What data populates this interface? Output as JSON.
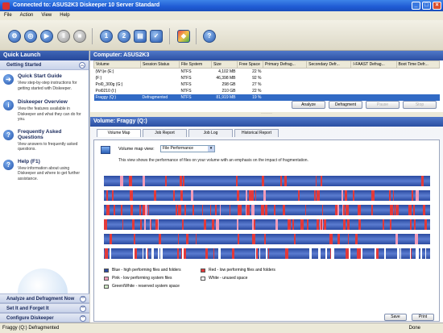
{
  "window": {
    "title": "Connected to: ASUS2K3 Diskeeper 10 Server Standard"
  },
  "menu": [
    "File",
    "Action",
    "View",
    "Help"
  ],
  "left_panel": {
    "header": "Quick Launch",
    "section": "Getting Started",
    "items": [
      {
        "title": "Quick Start Guide",
        "desc": "View step-by-step instructions for getting started with Diskeeper."
      },
      {
        "title": "Diskeeper Overview",
        "desc": "View the features available in Diskeeper and what they can do for you."
      },
      {
        "title": "Frequently Asked Questions",
        "desc": "View answers to frequently asked questions."
      },
      {
        "title": "Help (F1)",
        "desc": "View information about using Diskeeper and where to get further assistance."
      }
    ],
    "bottom_sections": [
      "Analyze and Defragment Now",
      "Set It and Forget It",
      "Configure Diskeeper"
    ]
  },
  "computer": {
    "header": "Computer: ASUS2K3",
    "columns": [
      "Volume",
      "Session Status",
      "File System",
      "Size",
      "Free Space",
      "Primary Defrag...",
      "Secondary Defr...",
      "I-FAAST Defrag...",
      "Boot Time Defr..."
    ],
    "rows": [
      {
        "volume": "(W:\\)e (E:)",
        "status": "",
        "fs": "NTFS",
        "size": "4,102 MB",
        "free": "22 %"
      },
      {
        "volume": "(F:)",
        "status": "",
        "fs": "NTFS",
        "size": "46,398 MB",
        "free": "92 %"
      },
      {
        "volume": "Pol0_300g (G:)",
        "status": "",
        "fs": "NTFS",
        "size": "298 GB",
        "free": "27 %"
      },
      {
        "volume": "Pol0210 (I:)",
        "status": "",
        "fs": "NTFS",
        "size": "210 GB",
        "free": "22 %"
      },
      {
        "volume": "Fraggy (Q:)",
        "status": "Defragmented",
        "fs": "NTFS",
        "size": "81,919 MB",
        "free": "19 %",
        "selected": true
      }
    ],
    "buttons": {
      "analyze": "Analyze",
      "defragment": "Defragment",
      "pause": "Pause",
      "stop": "Stop"
    }
  },
  "volume": {
    "header": "Volume: Fraggy (Q:)",
    "tabs": [
      "Volume Map",
      "Job Report",
      "Job Log",
      "Historical Report"
    ],
    "map_view_label": "Volume map view:",
    "map_view_value": "File Performance",
    "description": "This view shows the performance of files on your volume with an emphasis on the impact of fragmentation.",
    "legend": [
      {
        "label": "Blue - high performing files and folders",
        "color": "#2b4aa0"
      },
      {
        "label": "Red - low performing files and folders",
        "color": "#e33a3a"
      },
      {
        "label": "Pink - low performing system files",
        "color": "#f29bb8"
      },
      {
        "label": "White - unused space",
        "color": "#ffffff"
      },
      {
        "label": "Green/White - reserved system space",
        "color": "#cfe8c5"
      }
    ],
    "save": "Save",
    "print": "Print"
  },
  "status": {
    "left": "Fraggy (Q:) Defragmented",
    "right": "Done"
  }
}
